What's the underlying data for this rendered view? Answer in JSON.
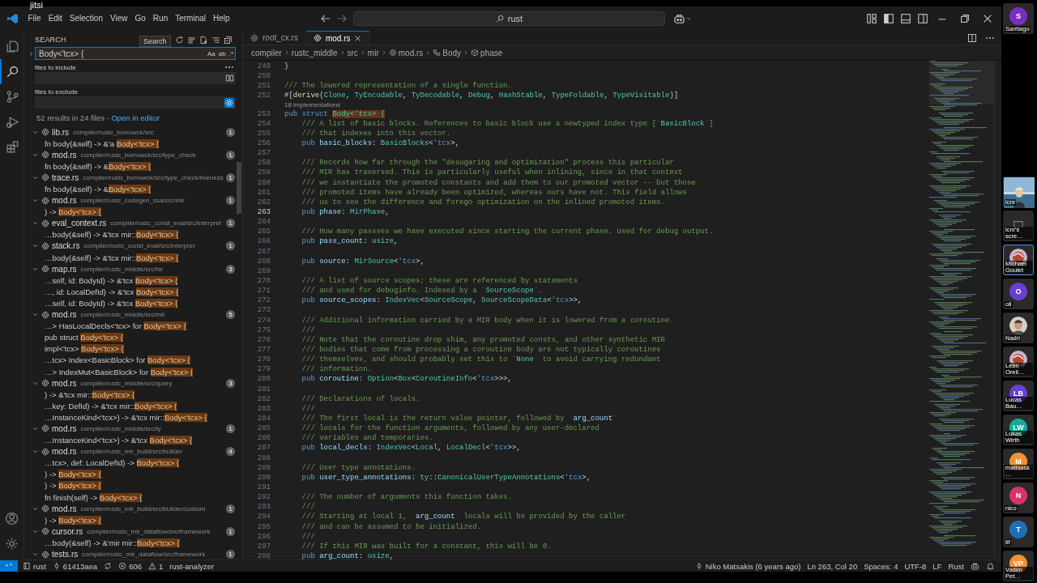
{
  "overlay_label": "jitsi",
  "titlebar": {
    "menus": [
      "File",
      "Edit",
      "Selection",
      "View",
      "Go",
      "Run",
      "Terminal",
      "Help"
    ],
    "command_center": "rust"
  },
  "activity_bar": [
    {
      "kind": "explorer",
      "selected": false
    },
    {
      "kind": "search",
      "selected": true
    },
    {
      "kind": "scm",
      "selected": false
    },
    {
      "kind": "debug",
      "selected": false
    },
    {
      "kind": "extensions",
      "selected": false
    }
  ],
  "search": {
    "title": "SEARCH",
    "tooltip": "Search",
    "query": "Body<'tcx> {",
    "toggles": [
      "Aa",
      "ab",
      ".*"
    ],
    "include_label": "files to include",
    "exclude_label": "files to exclude",
    "exclude_settings_on": true,
    "summary": "52 results in 24 files -",
    "summary_link": "Open in editor",
    "results": [
      {
        "file": "lib.rs",
        "path": "compiler/rustc_borrowck/src",
        "count": "1",
        "expanded": true,
        "matches": [
          {
            "pre": "fn body(&self) -> &'a ",
            "hit": "Body<'tcx> {"
          }
        ]
      },
      {
        "file": "mod.rs",
        "path": "compiler/rustc_borrowck/src/type_check",
        "count": "1",
        "expanded": true,
        "matches": [
          {
            "pre": "fn body(&self) -> &",
            "hit": "Body<'tcx> {"
          }
        ]
      },
      {
        "file": "trace.rs",
        "path": "compiler/rustc_borrowck/src/type_check/liveness",
        "count": "1",
        "expanded": true,
        "matches": [
          {
            "pre": "fn body(&self) -> &",
            "hit": "Body<'tcx> {"
          }
        ]
      },
      {
        "file": "mod.rs",
        "path": "compiler/rustc_codegen_ssa/src/mir",
        "count": "1",
        "expanded": true,
        "matches": [
          {
            "pre": ") -> ",
            "hit": "Body<'tcx> {"
          }
        ]
      },
      {
        "file": "eval_context.rs",
        "path": "compiler/rustc_const_eval/src/interpret",
        "count": "1",
        "expanded": true,
        "matches": [
          {
            "pre": "…body(&self) -> &'tcx mir::",
            "hit": "Body<'tcx> {"
          }
        ]
      },
      {
        "file": "stack.rs",
        "path": "compiler/rustc_const_eval/src/interpret",
        "count": "1",
        "expanded": true,
        "matches": [
          {
            "pre": "…body(&self) -> &'tcx mir::",
            "hit": "Body<'tcx> {"
          }
        ]
      },
      {
        "file": "map.rs",
        "path": "compiler/rustc_middle/src/hir",
        "count": "3",
        "expanded": true,
        "matches": [
          {
            "pre": "…self, id: BodyId) -> &'tcx ",
            "hit": "Body<'tcx> {"
          },
          {
            "pre": "…, id: LocalDefId) -> &'tcx ",
            "hit": "Body<'tcx> {"
          },
          {
            "pre": "…self, id: BodyId) -> &'tcx ",
            "hit": "Body<'tcx> {"
          }
        ]
      },
      {
        "file": "mod.rs",
        "path": "compiler/rustc_middle/src/mir",
        "count": "5",
        "expanded": true,
        "matches": [
          {
            "pre": "…> HasLocalDecls<'tcx> for ",
            "hit": "Body<'tcx> {"
          },
          {
            "pre": "pub struct ",
            "hit": "Body<'tcx> {"
          },
          {
            "pre": "impl<'tcx> ",
            "hit": "Body<'tcx> {"
          },
          {
            "pre": "…tcx> Index<BasicBlock> for ",
            "hit": "Body<'tcx> {"
          },
          {
            "pre": "…> IndexMut<BasicBlock> for ",
            "hit": "Body<'tcx> {"
          }
        ]
      },
      {
        "file": "mod.rs",
        "path": "compiler/rustc_middle/src/query",
        "count": "3",
        "expanded": true,
        "matches": [
          {
            "pre": ") -> &'tcx mir::",
            "hit": "Body<'tcx> {"
          },
          {
            "pre": "…key: DefId) -> &'tcx mir::",
            "hit": "Body<'tcx> {"
          },
          {
            "pre": "…InstanceKind<'tcx>) -> &'tcx mir::",
            "hit": "Body<'tcx> {"
          }
        ]
      },
      {
        "file": "mod.rs",
        "path": "compiler/rustc_middle/src/ty",
        "count": "1",
        "expanded": true,
        "matches": [
          {
            "pre": "…InstanceKind<'tcx>) -> &'tcx ",
            "hit": "Body<'tcx> {"
          }
        ]
      },
      {
        "file": "mod.rs",
        "path": "compiler/rustc_mir_build/src/builder",
        "count": "4",
        "expanded": true,
        "matches": [
          {
            "pre": "…tcx>, def: LocalDefId) -> ",
            "hit": "Body<'tcx> {"
          },
          {
            "pre": ") -> ",
            "hit": "Body<'tcx> {"
          },
          {
            "pre": ") -> ",
            "hit": "Body<'tcx> {"
          },
          {
            "pre": "fn finish(self) -> ",
            "hit": "Body<'tcx> {"
          }
        ]
      },
      {
        "file": "mod.rs",
        "path": "compiler/rustc_mir_build/src/builder/custom",
        "count": "1",
        "expanded": true,
        "matches": [
          {
            "pre": ") -> ",
            "hit": "Body<'tcx> {"
          }
        ]
      },
      {
        "file": "cursor.rs",
        "path": "compiler/rustc_mir_dataflow/src/framework",
        "count": "1",
        "expanded": true,
        "matches": [
          {
            "pre": "…body(&self) -> &'mir mir::",
            "hit": "Body<'tcx> {"
          }
        ]
      },
      {
        "file": "tests.rs",
        "path": "compiler/rustc_mir_dataflow/src/framework",
        "count": "1",
        "expanded": true
      }
    ]
  },
  "editor": {
    "tabs": [
      {
        "label": "root_cx.rs",
        "selected": false
      },
      {
        "label": "mod.rs",
        "selected": true
      }
    ],
    "breadcrumb": [
      {
        "label": "compiler",
        "kind": "folder"
      },
      {
        "label": "rustc_middle",
        "kind": "folder"
      },
      {
        "label": "src",
        "kind": "folder"
      },
      {
        "label": "mir",
        "kind": "folder"
      },
      {
        "label": "mod.rs",
        "kind": "file"
      },
      {
        "label": "Body",
        "kind": "struct"
      },
      {
        "label": "phase",
        "kind": "field"
      }
    ],
    "lines": [
      {
        "n": "249",
        "current": false,
        "segs": [
          {
            "text": "}",
            "kind": "p"
          }
        ]
      },
      {
        "n": "250",
        "current": false
      },
      {
        "n": "251",
        "current": false,
        "segs": [
          {
            "text": "/// The lowered representation of a single function.",
            "kind": "c"
          }
        ]
      },
      {
        "n": "252",
        "current": false,
        "segs": [
          {
            "text": "#[",
            "kind": "p"
          },
          {
            "text": "derive",
            "kind": "fn"
          },
          {
            "text": "(",
            "kind": "p"
          },
          {
            "text": "Clone",
            "kind": "type"
          },
          {
            "text": ", ",
            "kind": "p"
          },
          {
            "text": "TyEncodable",
            "kind": "type"
          },
          {
            "text": ", ",
            "kind": "p"
          },
          {
            "text": "TyDecodable",
            "kind": "type"
          },
          {
            "text": ", ",
            "kind": "p"
          },
          {
            "text": "Debug",
            "kind": "type"
          },
          {
            "text": ", ",
            "kind": "p"
          },
          {
            "text": "HashStable",
            "kind": "type"
          },
          {
            "text": ", ",
            "kind": "p"
          },
          {
            "text": "TypeFoldable",
            "kind": "type"
          },
          {
            "text": ", ",
            "kind": "p"
          },
          {
            "text": "TypeVisitable",
            "kind": "type"
          },
          {
            "text": ")]",
            "kind": "p"
          }
        ],
        "codelens": "18 implementations"
      },
      {
        "n": "253",
        "current": false,
        "segs": [
          {
            "text": "pub struct ",
            "kind": "kw"
          },
          {
            "text": "Body<'tcx> {",
            "kind": "m"
          }
        ]
      },
      {
        "n": "254",
        "current": false,
        "segs": [
          {
            "text": "    /// A list of basic blocks. References to basic block use a newtyped index type [`",
            "kind": "c"
          },
          {
            "text": "BasicBlock",
            "kind": "type"
          },
          {
            "text": "`]",
            "kind": "c"
          }
        ]
      },
      {
        "n": "255",
        "current": false,
        "segs": [
          {
            "text": "    /// that indexes into this vector.",
            "kind": "c"
          }
        ]
      },
      {
        "n": "256",
        "current": false,
        "segs": [
          {
            "text": "    pub ",
            "kind": "kw"
          },
          {
            "text": "basic_blocks",
            "kind": "var"
          },
          {
            "text": ": ",
            "kind": "p"
          },
          {
            "text": "BasicBlocks",
            "kind": "type"
          },
          {
            "text": "<",
            "kind": "p"
          },
          {
            "text": "'tcx",
            "kind": "kw"
          },
          {
            "text": ">,",
            "kind": "p"
          }
        ]
      },
      {
        "n": "257",
        "current": false
      },
      {
        "n": "258",
        "current": false,
        "segs": [
          {
            "text": "    /// Records how far through the \"desugaring and optimization\" process this particular",
            "kind": "c"
          }
        ]
      },
      {
        "n": "259",
        "current": false,
        "segs": [
          {
            "text": "    /// MIR has traversed. This is particularly useful when inlining, since in that context",
            "kind": "c"
          }
        ]
      },
      {
        "n": "260",
        "current": false,
        "segs": [
          {
            "text": "    /// we instantiate the promoted constants and add them to our promoted vector -- but those",
            "kind": "c"
          }
        ]
      },
      {
        "n": "261",
        "current": false,
        "segs": [
          {
            "text": "    /// promoted items have already been optimized, whereas ours have not. This field allows",
            "kind": "c"
          }
        ]
      },
      {
        "n": "262",
        "current": false,
        "segs": [
          {
            "text": "    /// us to see the difference and forego optimization on the inlined promoted items.",
            "kind": "c"
          }
        ]
      },
      {
        "n": "263",
        "current": true,
        "segs": [
          {
            "text": "    pub ",
            "kind": "kw"
          },
          {
            "text": "phase",
            "kind": "var"
          },
          {
            "text": ": ",
            "kind": "p"
          },
          {
            "text": "MirPhase",
            "kind": "type"
          },
          {
            "text": ",",
            "kind": "p"
          }
        ]
      },
      {
        "n": "264",
        "current": false
      },
      {
        "n": "265",
        "current": false,
        "segs": [
          {
            "text": "    /// How many passses we have executed since starting the current phase. Used for debug output.",
            "kind": "c"
          }
        ]
      },
      {
        "n": "266",
        "current": false,
        "segs": [
          {
            "text": "    pub ",
            "kind": "kw"
          },
          {
            "text": "pass_count",
            "kind": "var"
          },
          {
            "text": ": ",
            "kind": "p"
          },
          {
            "text": "usize",
            "kind": "type"
          },
          {
            "text": ",",
            "kind": "p"
          }
        ]
      },
      {
        "n": "267",
        "current": false
      },
      {
        "n": "268",
        "current": false,
        "segs": [
          {
            "text": "    pub ",
            "kind": "kw"
          },
          {
            "text": "source",
            "kind": "var"
          },
          {
            "text": ": ",
            "kind": "p"
          },
          {
            "text": "MirSource",
            "kind": "type"
          },
          {
            "text": "<",
            "kind": "p"
          },
          {
            "text": "'tcx",
            "kind": "kw"
          },
          {
            "text": ">,",
            "kind": "p"
          }
        ]
      },
      {
        "n": "269",
        "current": false
      },
      {
        "n": "270",
        "current": false,
        "segs": [
          {
            "text": "    /// A list of source scopes; these are referenced by statements",
            "kind": "c"
          }
        ]
      },
      {
        "n": "271",
        "current": false,
        "segs": [
          {
            "text": "    /// and used for debuginfo. Indexed by a `",
            "kind": "c"
          },
          {
            "text": "SourceScope",
            "kind": "type"
          },
          {
            "text": "`.",
            "kind": "c"
          }
        ]
      },
      {
        "n": "272",
        "current": false,
        "segs": [
          {
            "text": "    pub ",
            "kind": "kw"
          },
          {
            "text": "source_scopes",
            "kind": "var"
          },
          {
            "text": ": ",
            "kind": "p"
          },
          {
            "text": "IndexVec",
            "kind": "type"
          },
          {
            "text": "<",
            "kind": "p"
          },
          {
            "text": "SourceScope",
            "kind": "type"
          },
          {
            "text": ", ",
            "kind": "p"
          },
          {
            "text": "SourceScopeData",
            "kind": "type"
          },
          {
            "text": "<",
            "kind": "p"
          },
          {
            "text": "'tcx",
            "kind": "kw"
          },
          {
            "text": ">>,",
            "kind": "p"
          }
        ]
      },
      {
        "n": "273",
        "current": false
      },
      {
        "n": "274",
        "current": false,
        "segs": [
          {
            "text": "    /// Additional information carried by a MIR body when it is lowered from a coroutine.",
            "kind": "c"
          }
        ]
      },
      {
        "n": "275",
        "current": false,
        "segs": [
          {
            "text": "    ///",
            "kind": "c"
          }
        ]
      },
      {
        "n": "276",
        "current": false,
        "segs": [
          {
            "text": "    /// Note that the coroutine drop shim, any promoted consts, and other synthetic MIR",
            "kind": "c"
          }
        ]
      },
      {
        "n": "277",
        "current": false,
        "segs": [
          {
            "text": "    /// bodies that come from processing a coroutine body are not typically coroutines",
            "kind": "c"
          }
        ]
      },
      {
        "n": "278",
        "current": false,
        "segs": [
          {
            "text": "    /// themselves, and should probably set this to `",
            "kind": "c"
          },
          {
            "text": "None",
            "kind": "type"
          },
          {
            "text": "` to avoid carrying redundant",
            "kind": "c"
          }
        ]
      },
      {
        "n": "279",
        "current": false,
        "segs": [
          {
            "text": "    /// information.",
            "kind": "c"
          }
        ]
      },
      {
        "n": "280",
        "current": false,
        "segs": [
          {
            "text": "    pub ",
            "kind": "kw"
          },
          {
            "text": "coroutine",
            "kind": "var"
          },
          {
            "text": ": ",
            "kind": "p"
          },
          {
            "text": "Option",
            "kind": "type"
          },
          {
            "text": "<",
            "kind": "p"
          },
          {
            "text": "Box",
            "kind": "type"
          },
          {
            "text": "<",
            "kind": "p"
          },
          {
            "text": "CoroutineInfo",
            "kind": "type"
          },
          {
            "text": "<",
            "kind": "p"
          },
          {
            "text": "'tcx",
            "kind": "kw"
          },
          {
            "text": ">>>,",
            "kind": "p"
          }
        ]
      },
      {
        "n": "281",
        "current": false
      },
      {
        "n": "282",
        "current": false,
        "segs": [
          {
            "text": "    /// Declarations of locals.",
            "kind": "c"
          }
        ]
      },
      {
        "n": "283",
        "current": false,
        "segs": [
          {
            "text": "    ///",
            "kind": "c"
          }
        ]
      },
      {
        "n": "284",
        "current": false,
        "segs": [
          {
            "text": "    /// The first local is the return value pointer, followed by `",
            "kind": "c"
          },
          {
            "text": "arg_count",
            "kind": "var"
          },
          {
            "text": "`",
            "kind": "c"
          }
        ]
      },
      {
        "n": "285",
        "current": false,
        "segs": [
          {
            "text": "    /// locals for the function arguments, followed by any user-declared",
            "kind": "c"
          }
        ]
      },
      {
        "n": "286",
        "current": false,
        "segs": [
          {
            "text": "    /// variables and temporaries.",
            "kind": "c"
          }
        ]
      },
      {
        "n": "287",
        "current": false,
        "segs": [
          {
            "text": "    pub ",
            "kind": "kw"
          },
          {
            "text": "local_decls",
            "kind": "var"
          },
          {
            "text": ": ",
            "kind": "p"
          },
          {
            "text": "IndexVec",
            "kind": "type"
          },
          {
            "text": "<",
            "kind": "p"
          },
          {
            "text": "Local",
            "kind": "type"
          },
          {
            "text": ", ",
            "kind": "p"
          },
          {
            "text": "LocalDecl",
            "kind": "type"
          },
          {
            "text": "<",
            "kind": "p"
          },
          {
            "text": "'tcx",
            "kind": "kw"
          },
          {
            "text": ">>,",
            "kind": "p"
          }
        ]
      },
      {
        "n": "288",
        "current": false
      },
      {
        "n": "289",
        "current": false,
        "segs": [
          {
            "text": "    /// User type annotations.",
            "kind": "c"
          }
        ]
      },
      {
        "n": "290",
        "current": false,
        "segs": [
          {
            "text": "    pub ",
            "kind": "kw"
          },
          {
            "text": "user_type_annotations",
            "kind": "var"
          },
          {
            "text": ": ",
            "kind": "p"
          },
          {
            "text": "ty",
            "kind": "type"
          },
          {
            "text": "::",
            "kind": "p"
          },
          {
            "text": "CanonicalUserTypeAnnotations",
            "kind": "type"
          },
          {
            "text": "<",
            "kind": "p"
          },
          {
            "text": "'tcx",
            "kind": "kw"
          },
          {
            "text": ">,",
            "kind": "p"
          }
        ]
      },
      {
        "n": "291",
        "current": false
      },
      {
        "n": "292",
        "current": false,
        "segs": [
          {
            "text": "    /// The number of arguments this function takes.",
            "kind": "c"
          }
        ]
      },
      {
        "n": "293",
        "current": false,
        "segs": [
          {
            "text": "    ///",
            "kind": "c"
          }
        ]
      },
      {
        "n": "294",
        "current": false,
        "segs": [
          {
            "text": "    /// Starting at local 1, `",
            "kind": "c"
          },
          {
            "text": "arg_count",
            "kind": "var"
          },
          {
            "text": "` locals will be provided by the caller",
            "kind": "c"
          }
        ]
      },
      {
        "n": "295",
        "current": false,
        "segs": [
          {
            "text": "    /// and can be assumed to be initialized.",
            "kind": "c"
          }
        ]
      },
      {
        "n": "296",
        "current": false,
        "segs": [
          {
            "text": "    ///",
            "kind": "c"
          }
        ]
      },
      {
        "n": "297",
        "current": false,
        "segs": [
          {
            "text": "    /// If this MIR was built for a constant, this will be 0.",
            "kind": "c"
          }
        ]
      },
      {
        "n": "298",
        "current": false,
        "segs": [
          {
            "text": "    pub ",
            "kind": "kw"
          },
          {
            "text": "arg_count",
            "kind": "var"
          },
          {
            "text": ": ",
            "kind": "p"
          },
          {
            "text": "usize",
            "kind": "type"
          },
          {
            "text": ",",
            "kind": "p"
          }
        ]
      }
    ]
  },
  "status_bar": {
    "branch": "rust",
    "commit": "61413aea",
    "errors": "606",
    "warnings": "1",
    "language_server": "rust-analyzer",
    "blame": "Niko Matsakis (6 years ago)",
    "position": "Ln 263, Col 20",
    "indentation": "Spaces: 4",
    "encoding": "UTF-8",
    "line_ending": "LF",
    "language": "Rust"
  },
  "participants": [
    {
      "name": "Santiago",
      "kind": "initials",
      "initials": "S",
      "color": "#7b2fbe",
      "selected": false
    },
    {
      "name": "lcnr",
      "kind": "video",
      "selected": false
    },
    {
      "name": "lcnr's scre…",
      "kind": "screen",
      "selected": false
    },
    {
      "name": "Michael Goulet",
      "selected": true
    },
    {
      "name": "oli",
      "kind": "initials",
      "initials": "O",
      "color": "#6a3fd0",
      "selected": false
    },
    {
      "name": "Nadri",
      "selected": false
    },
    {
      "name": "León Orell…",
      "selected": false
    },
    {
      "name": "Lucas Bau…",
      "kind": "initials",
      "initials": "LB",
      "color": "#6a3fd0",
      "selected": false
    },
    {
      "name": "Lukas Wirth",
      "kind": "initials",
      "initials": "LW",
      "color": "#1aa89a",
      "selected": false
    },
    {
      "name": "mathiask…",
      "kind": "initials",
      "initials": "M",
      "color": "#f0913a",
      "selected": false
    },
    {
      "name": "nico",
      "kind": "initials",
      "initials": "N",
      "color": "#d6336c",
      "selected": false
    },
    {
      "name": "tif",
      "kind": "initials",
      "initials": "T",
      "color": "#1f6fb8",
      "selected": false
    },
    {
      "name": "Vadim Pet…",
      "kind": "initials",
      "initials": "VP",
      "color": "#f0913a",
      "selected": false
    }
  ]
}
